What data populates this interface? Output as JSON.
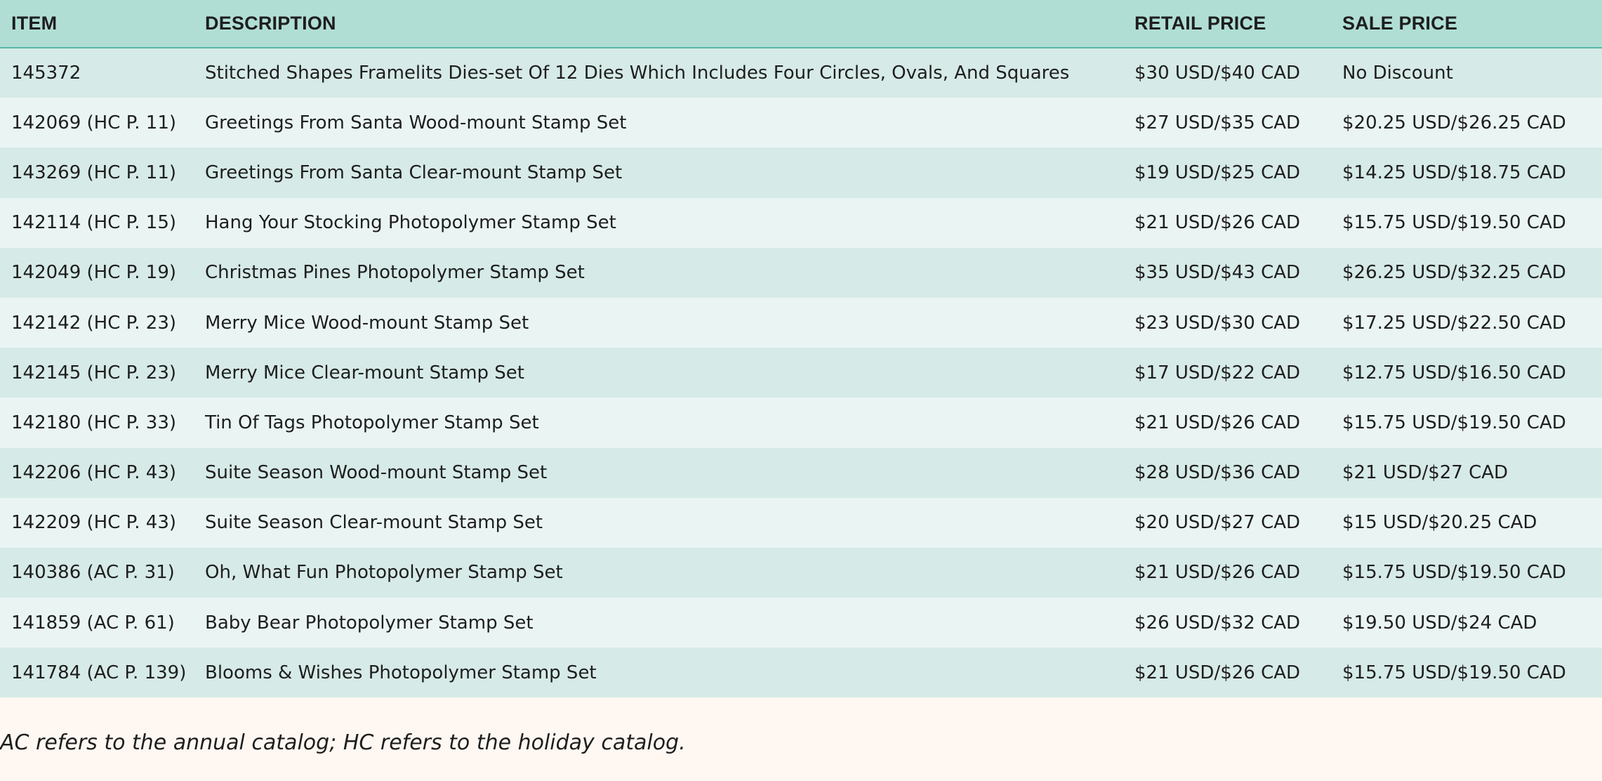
{
  "table": {
    "headers": {
      "item": "ITEM",
      "description": "DESCRIPTION",
      "retail_price": "RETAIL PRICE",
      "sale_price": "SALE PRICE"
    },
    "rows": [
      {
        "item": "145372",
        "description": "Stitched Shapes Framelits Dies-set Of 12 Dies Which Includes Four Circles, Ovals, And Squares",
        "retail": "$30 USD/$40 CAD",
        "sale": "No Discount"
      },
      {
        "item": "142069 (HC P. 11)",
        "description": "Greetings From Santa Wood-mount Stamp Set",
        "retail": "$27 USD/$35 CAD",
        "sale": "$20.25 USD/$26.25 CAD"
      },
      {
        "item": "143269 (HC P. 11)",
        "description": "Greetings From Santa Clear-mount Stamp Set",
        "retail": "$19 USD/$25 CAD",
        "sale": "$14.25 USD/$18.75 CAD"
      },
      {
        "item": "142114 (HC P. 15)",
        "description": "Hang Your Stocking Photopolymer Stamp Set",
        "retail": "$21 USD/$26 CAD",
        "sale": "$15.75 USD/$19.50 CAD"
      },
      {
        "item": "142049 (HC P. 19)",
        "description": "Christmas Pines Photopolymer Stamp Set",
        "retail": "$35 USD/$43 CAD",
        "sale": "$26.25 USD/$32.25 CAD"
      },
      {
        "item": "142142 (HC P. 23)",
        "description": "Merry Mice Wood-mount Stamp Set",
        "retail": "$23 USD/$30 CAD",
        "sale": "$17.25 USD/$22.50 CAD"
      },
      {
        "item": "142145 (HC P. 23)",
        "description": "Merry Mice Clear-mount Stamp Set",
        "retail": "$17 USD/$22 CAD",
        "sale": "$12.75 USD/$16.50 CAD"
      },
      {
        "item": "142180 (HC P. 33)",
        "description": "Tin Of Tags Photopolymer Stamp Set",
        "retail": "$21 USD/$26 CAD",
        "sale": "$15.75 USD/$19.50 CAD"
      },
      {
        "item": "142206 (HC P. 43)",
        "description": "Suite Season Wood-mount Stamp Set",
        "retail": "$28 USD/$36 CAD",
        "sale": "$21 USD/$27 CAD"
      },
      {
        "item": "142209 (HC P. 43)",
        "description": "Suite Season Clear-mount Stamp Set",
        "retail": "$20 USD/$27 CAD",
        "sale": "$15 USD/$20.25 CAD"
      },
      {
        "item": "140386 (AC P. 31)",
        "description": "Oh, What Fun Photopolymer Stamp Set",
        "retail": "$21 USD/$26 CAD",
        "sale": "$15.75 USD/$19.50 CAD"
      },
      {
        "item": "141859 (AC P. 61)",
        "description": "Baby Bear Photopolymer Stamp Set",
        "retail": "$26 USD/$32 CAD",
        "sale": "$19.50 USD/$24 CAD"
      },
      {
        "item": "141784 (AC P. 139)",
        "description": "Blooms & Wishes Photopolymer Stamp Set",
        "retail": "$21 USD/$26 CAD",
        "sale": "$15.75 USD/$19.50 CAD"
      }
    ]
  },
  "footnote": "AC refers to the annual catalog; HC refers to the holiday catalog.",
  "colors": {
    "header_bg": "#b0ded5",
    "row_odd": "#d6eae7",
    "row_even": "#eaf5f3",
    "page_bg": "#fff8f2"
  }
}
